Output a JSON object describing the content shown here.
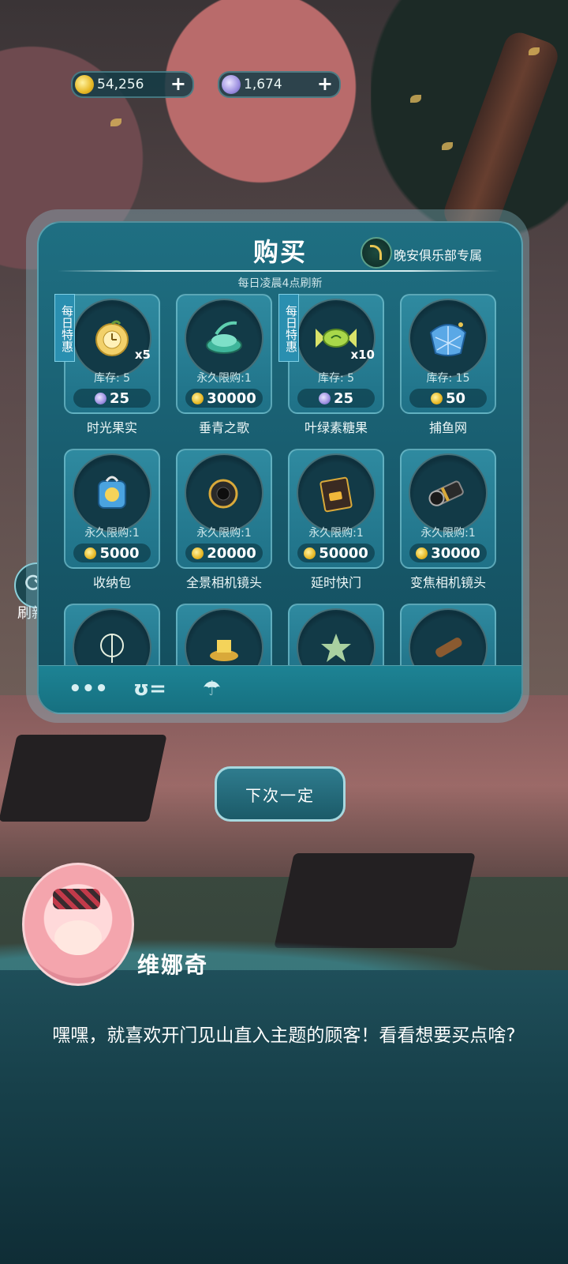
{
  "currencies": {
    "coins": {
      "value": "54,256",
      "icon": "gold-coin-icon"
    },
    "moons": {
      "value": "1,674",
      "icon": "moon-gem-icon"
    }
  },
  "shop": {
    "title": "购买",
    "club_label": "晚安俱乐部专属",
    "refresh_note": "每日凌晨4点刷新",
    "items": [
      {
        "name": "时光果实",
        "tag": "每日特惠",
        "qty": "x5",
        "stock": "库存: 5",
        "price": "25",
        "currency": "moon"
      },
      {
        "name": "垂青之歌",
        "tag": "",
        "qty": "",
        "stock": "永久限购:1",
        "price": "30000",
        "currency": "coin"
      },
      {
        "name": "叶绿素糖果",
        "tag": "每日特惠",
        "qty": "x10",
        "stock": "库存: 5",
        "price": "25",
        "currency": "moon"
      },
      {
        "name": "捕鱼网",
        "tag": "",
        "qty": "",
        "stock": "库存: 15",
        "price": "50",
        "currency": "coin"
      },
      {
        "name": "收纳包",
        "tag": "",
        "qty": "",
        "stock": "永久限购:1",
        "price": "5000",
        "currency": "coin"
      },
      {
        "name": "全景相机镜头",
        "tag": "",
        "qty": "",
        "stock": "永久限购:1",
        "price": "20000",
        "currency": "coin"
      },
      {
        "name": "延时快门",
        "tag": "",
        "qty": "",
        "stock": "永久限购:1",
        "price": "50000",
        "currency": "coin"
      },
      {
        "name": "变焦相机镜头",
        "tag": "",
        "qty": "",
        "stock": "永久限购:1",
        "price": "30000",
        "currency": "coin"
      }
    ],
    "bottom_icons": [
      "more-dots-icon",
      "chat-icon",
      "umbrella-icon"
    ]
  },
  "side_refresh_label": "刷新",
  "next_button": "下次一定",
  "dialog": {
    "speaker": "维娜奇",
    "text": "嘿嘿，就喜欢开门见山直入主题的顾客！看看想要买点啥?"
  },
  "colors": {
    "panel": "#1f6f82",
    "card": "#2f8aa0",
    "coin": "#e7b825",
    "moon": "#9c8fe0",
    "dialog": "#1f4f5a"
  }
}
